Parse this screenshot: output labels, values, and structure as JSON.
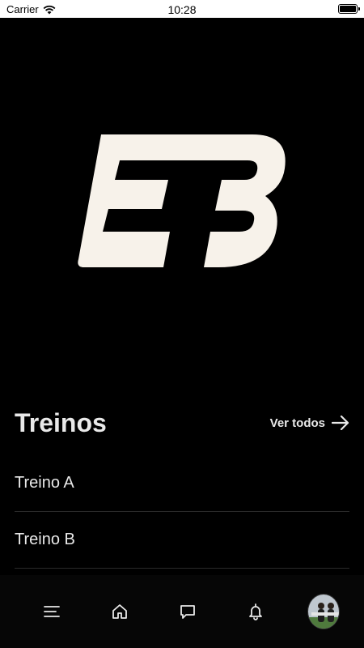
{
  "status_bar": {
    "carrier": "Carrier",
    "time": "10:28"
  },
  "brand": {
    "logo_color": "#f7f2ea"
  },
  "section": {
    "title": "Treinos",
    "see_all_label": "Ver todos"
  },
  "workouts": [
    {
      "label": "Treino A"
    },
    {
      "label": "Treino B"
    }
  ],
  "tabbar": {
    "icons": [
      "menu-icon",
      "home-icon",
      "chat-icon",
      "bell-icon",
      "avatar"
    ]
  },
  "colors": {
    "background": "#000000",
    "text": "#e9e9e9",
    "divider": "#2a2a2a"
  }
}
